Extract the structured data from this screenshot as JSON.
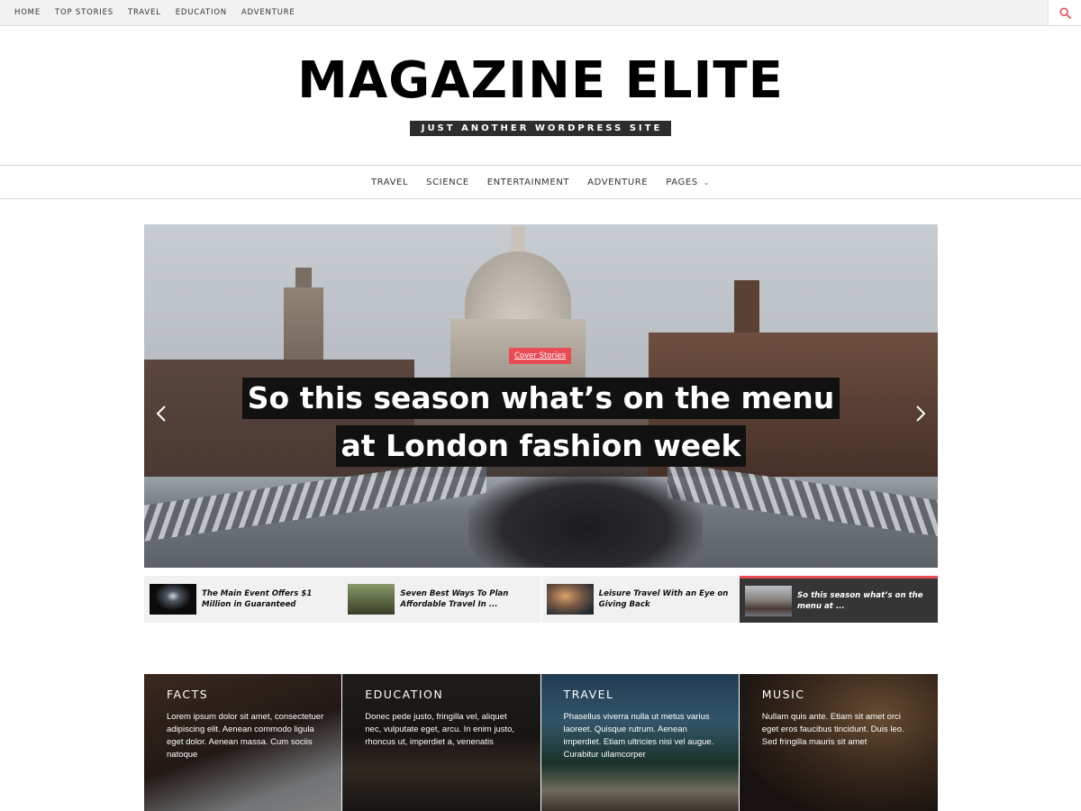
{
  "topnav": {
    "items": [
      "HOME",
      "TOP STORIES",
      "TRAVEL",
      "EDUCATION",
      "ADVENTURE"
    ],
    "search_icon": "search-icon"
  },
  "header": {
    "title": "MAGAZINE ELITE",
    "tagline": "JUST ANOTHER WORDPRESS SITE"
  },
  "mainnav": {
    "items": [
      "TRAVEL",
      "SCIENCE",
      "ENTERTAINMENT",
      "ADVENTURE",
      "PAGES"
    ]
  },
  "slider": {
    "category": "Cover Stories",
    "title_line1": "So this season what’s on the menu",
    "title_line2": "at London fashion week",
    "prev_icon": "chevron-left-icon",
    "next_icon": "chevron-right-icon"
  },
  "thumbnails": [
    {
      "title": "The Main Event Offers $1 Million in Guaranteed"
    },
    {
      "title": "Seven Best Ways To Plan Affordable Travel In ..."
    },
    {
      "title": "Leisure Travel With an Eye on Giving Back"
    },
    {
      "title": "So this season what’s on the menu at ..."
    }
  ],
  "categories": [
    {
      "name": "FACTS",
      "desc": "Lorem ipsum dolor sit amet, consectetuer adipiscing elit. Aenean commodo ligula eget dolor. Aenean massa. Cum sociis natoque"
    },
    {
      "name": "EDUCATION",
      "desc": "Donec pede justo, fringilla vel, aliquet nec, vulputate eget, arcu. In enim justo, rhoncus ut, imperdiet a, venenatis"
    },
    {
      "name": "TRAVEL",
      "desc": "Phasellus viverra nulla ut metus varius laoreet. Quisque rutrum. Aenean imperdiet. Etiam ultricies nisi vel augue. Curabitur ullamcorper"
    },
    {
      "name": "MUSIC",
      "desc": "Nullam quis ante. Etiam sit amet orci eget eros faucibus tincidunt. Duis leo. Sed fringilla mauris sit amet"
    }
  ],
  "colors": {
    "accent": "#e94c55",
    "dark": "#2d2d2d",
    "topbar": "#f2f2f2"
  }
}
